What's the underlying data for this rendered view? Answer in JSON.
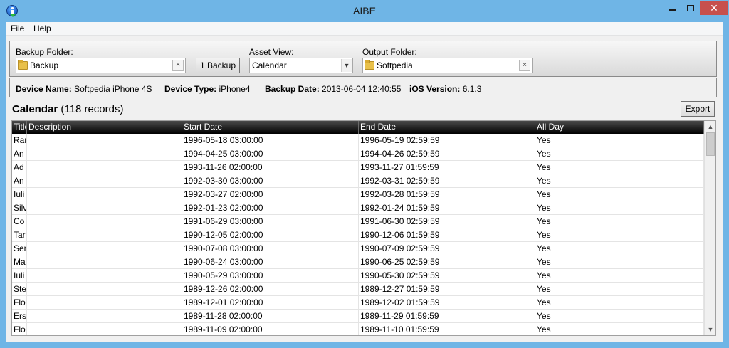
{
  "window": {
    "title": "AIBE"
  },
  "menu": {
    "items": [
      "File",
      "Help"
    ]
  },
  "backup_folder": {
    "label": "Backup Folder:",
    "value": "Backup",
    "clear": "×"
  },
  "backup_button": {
    "label": "1 Backup"
  },
  "asset_view": {
    "label": "Asset View:",
    "value": "Calendar"
  },
  "output_folder": {
    "label": "Output Folder:",
    "value": "Softpedia",
    "clear": "×"
  },
  "device": {
    "name_label": "Device Name:",
    "name": "Softpedia iPhone 4S",
    "type_label": "Device Type:",
    "type": "iPhone4",
    "backup_date_label": "Backup Date:",
    "backup_date": "2013-06-04 12:40:55",
    "ios_label": "iOS Version:",
    "ios": "6.1.3"
  },
  "section": {
    "title": "Calendar",
    "count": "(118 records)",
    "export_label": "Export"
  },
  "table": {
    "columns": [
      "Title",
      "Description",
      "Start Date",
      "End Date",
      "All Day"
    ],
    "rows": [
      [
        "Rar",
        "",
        "1996-05-18 03:00:00",
        "1996-05-19 02:59:59",
        "Yes"
      ],
      [
        "An",
        "",
        "1994-04-25 03:00:00",
        "1994-04-26 02:59:59",
        "Yes"
      ],
      [
        "Ad",
        "",
        "1993-11-26 02:00:00",
        "1993-11-27 01:59:59",
        "Yes"
      ],
      [
        "An",
        "",
        "1992-03-30 03:00:00",
        "1992-03-31 02:59:59",
        "Yes"
      ],
      [
        "Iuli",
        "",
        "1992-03-27 02:00:00",
        "1992-03-28 01:59:59",
        "Yes"
      ],
      [
        "Silv",
        "",
        "1992-01-23 02:00:00",
        "1992-01-24 01:59:59",
        "Yes"
      ],
      [
        "Co",
        "",
        "1991-06-29 03:00:00",
        "1991-06-30 02:59:59",
        "Yes"
      ],
      [
        "Tar",
        "",
        "1990-12-05 02:00:00",
        "1990-12-06 01:59:59",
        "Yes"
      ],
      [
        "Ser",
        "",
        "1990-07-08 03:00:00",
        "1990-07-09 02:59:59",
        "Yes"
      ],
      [
        "Ma",
        "",
        "1990-06-24 03:00:00",
        "1990-06-25 02:59:59",
        "Yes"
      ],
      [
        "Iuli",
        "",
        "1990-05-29 03:00:00",
        "1990-05-30 02:59:59",
        "Yes"
      ],
      [
        "Ste",
        "",
        "1989-12-26 02:00:00",
        "1989-12-27 01:59:59",
        "Yes"
      ],
      [
        "Flo",
        "",
        "1989-12-01 02:00:00",
        "1989-12-02 01:59:59",
        "Yes"
      ],
      [
        "Ers",
        "",
        "1989-11-28 02:00:00",
        "1989-11-29 01:59:59",
        "Yes"
      ],
      [
        "Flo",
        "",
        "1989-11-09 02:00:00",
        "1989-11-10 01:59:59",
        "Yes"
      ]
    ]
  }
}
